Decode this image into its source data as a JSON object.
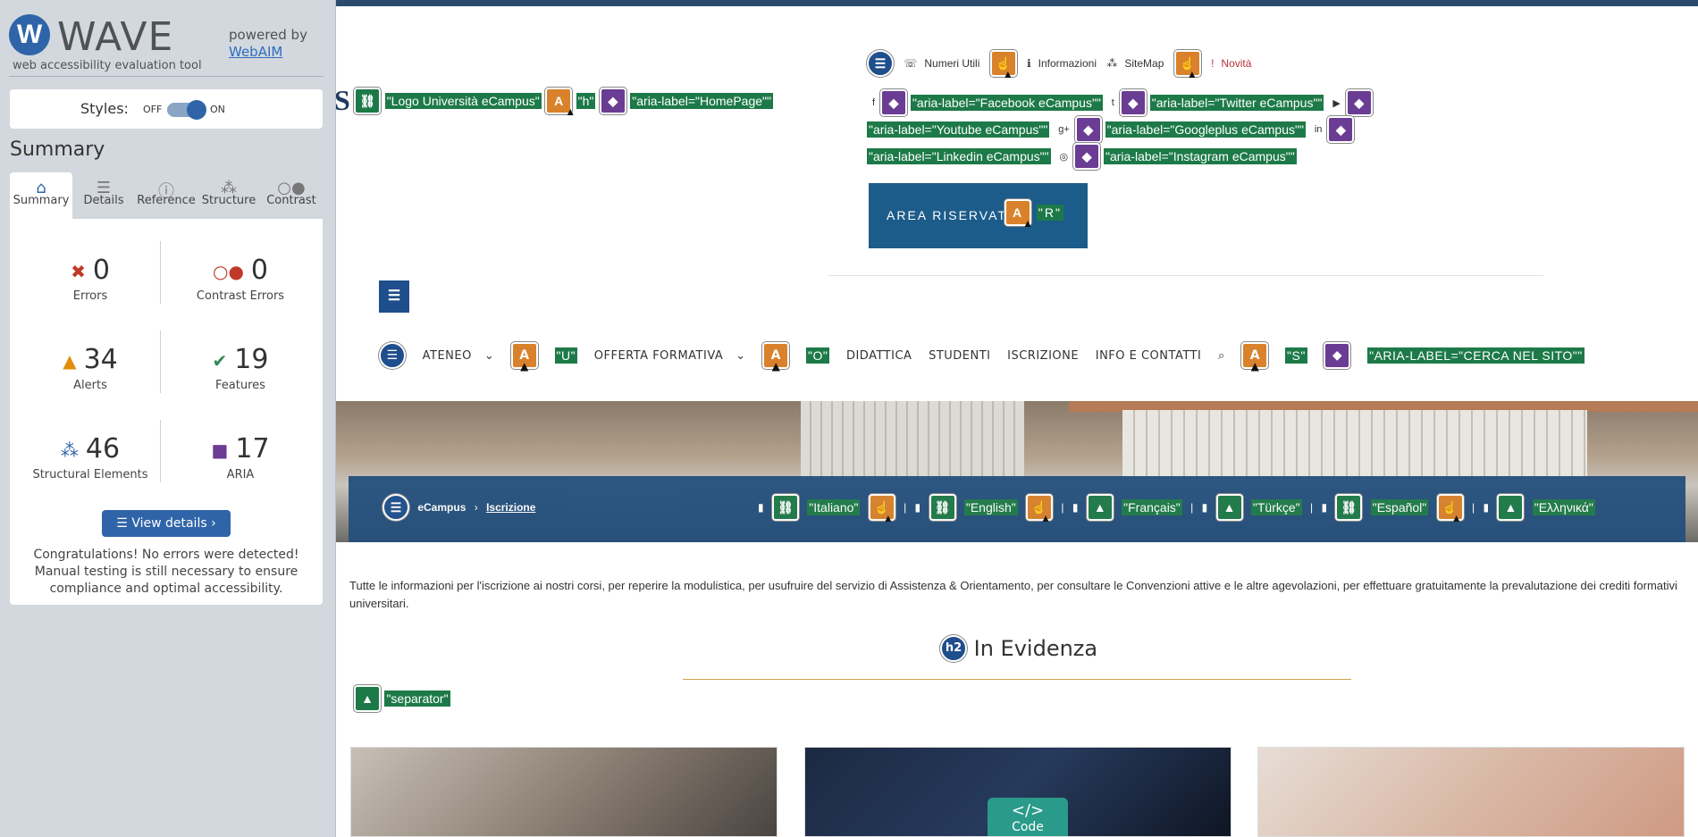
{
  "wave": {
    "logo_letter": "W",
    "logo_text": "WAVE",
    "tagline": "web accessibility evaluation tool",
    "powered_by": "powered by",
    "webaim_link": "WebAIM",
    "styles_label": "Styles:",
    "styles_off": "OFF",
    "styles_on": "ON",
    "summary_title": "Summary",
    "tabs": [
      {
        "label": "Summary",
        "icon": "home-icon"
      },
      {
        "label": "Details",
        "icon": "list-icon"
      },
      {
        "label": "Reference",
        "icon": "info-icon"
      },
      {
        "label": "Structure",
        "icon": "structure-icon"
      },
      {
        "label": "Contrast",
        "icon": "contrast-icon"
      }
    ],
    "stats": {
      "errors": {
        "value": "0",
        "label": "Errors"
      },
      "contrast_errors": {
        "value": "0",
        "label": "Contrast Errors"
      },
      "alerts": {
        "value": "34",
        "label": "Alerts"
      },
      "features": {
        "value": "19",
        "label": "Features"
      },
      "structural": {
        "value": "46",
        "label": "Structural Elements"
      },
      "aria": {
        "value": "17",
        "label": "ARIA"
      }
    },
    "view_details": "View details ›",
    "congrats": "Congratulations! No errors were detected! Manual testing is still necessary to ensure compliance and optimal accessibility."
  },
  "site": {
    "logo_label": "\"Logo Università eCampus\"",
    "h_label": "\"h\"",
    "homepage_aria": "\"aria-label=\"HomePage\"\"",
    "top_links": {
      "numeri_utili": "Numeri Utili",
      "informazioni": "Informazioni",
      "sitemap": "SiteMap",
      "novita": "Novità"
    },
    "social": [
      "\"aria-label=\"Facebook eCampus\"\"",
      "\"aria-label=\"Twitter eCampus\"\"",
      "\"aria-label=\"Youtube eCampus\"\"",
      "\"aria-label=\"Googleplus eCampus\"\"",
      "\"aria-label=\"Linkedin eCampus\"\"",
      "\"aria-label=\"Instagram eCampus\"\""
    ],
    "area_riservata": "AREA RISERVATA",
    "area_label": "\"R\"",
    "nav": {
      "ateneo": "ATENEO",
      "u_label": "\"U\"",
      "offerta": "OFFERTA FORMATIVA",
      "o_label": "\"O\"",
      "didattica": "DIDATTICA",
      "studenti": "STUDENTI",
      "iscrizione": "ISCRIZIONE",
      "info": "INFO E CONTATTI",
      "s_label": "\"S\"",
      "search_aria": "\"ARIA-LABEL=\"CERCA NEL SITO\"\""
    },
    "breadcrumb": {
      "home": "eCampus",
      "current": "Iscrizione"
    },
    "languages": [
      "\"Italiano\"",
      "\"English\"",
      "\"Français\"",
      "\"Türkçe\"",
      "\"Español\"",
      "\"Ελληνικά\""
    ],
    "intro": "Tutte le informazioni per l'iscrizione ai nostri corsi, per reperire la modulistica, per usufruire del servizio di Assistenza & Orientamento, per consultare le Convenzioni attive e le altre agevolazioni, per effettuare gratuitamente la prevalutazione dei crediti formativi universitari.",
    "h2_badge": "h2",
    "h2_title": "In Evidenza",
    "separator": "\"separator\"",
    "code_label": "Code"
  }
}
